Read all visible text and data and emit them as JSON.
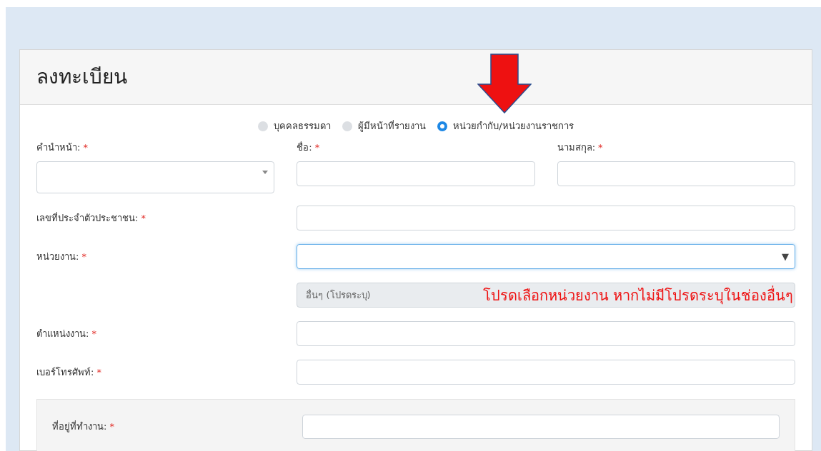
{
  "card": {
    "title": "ลงทะเบียน"
  },
  "user_types": [
    {
      "label": "บุคคลธรรมดา",
      "selected": false
    },
    {
      "label": "ผู้มีหน้าที่รายงาน",
      "selected": false
    },
    {
      "label": "หน่วยกำกับ/หน่วยงานราชการ",
      "selected": true
    }
  ],
  "name_fields": [
    {
      "label": "คำนำหน้า:",
      "required_mark": "*",
      "kind": "select"
    },
    {
      "label": "ชื่อ:",
      "required_mark": "*",
      "kind": "text"
    },
    {
      "label": "นามสกุล:",
      "required_mark": "*",
      "kind": "text"
    }
  ],
  "rows": [
    {
      "label": "เลขที่ประจำตัวประชาชน:",
      "required_mark": "*",
      "kind": "text",
      "focused": false
    },
    {
      "label": "หน่วยงาน:",
      "required_mark": "*",
      "kind": "select",
      "focused": true,
      "caret": "▼"
    },
    {
      "kind": "disabled",
      "placeholder": "อื่นๆ (โปรดระบุ)"
    },
    {
      "label": "ตำแหน่งงาน:",
      "required_mark": "*",
      "kind": "text",
      "focused": false
    },
    {
      "label": "เบอร์โทรศัพท์:",
      "required_mark": "*",
      "kind": "text",
      "focused": false
    }
  ],
  "address_section": {
    "label": "ที่อยู่ที่ทำงาน:",
    "required_mark": "*"
  },
  "annotation": {
    "text": "โปรดเลือกหน่วยงาน หากไม่มีโปรดระบุในช่องอื่นๆ"
  }
}
